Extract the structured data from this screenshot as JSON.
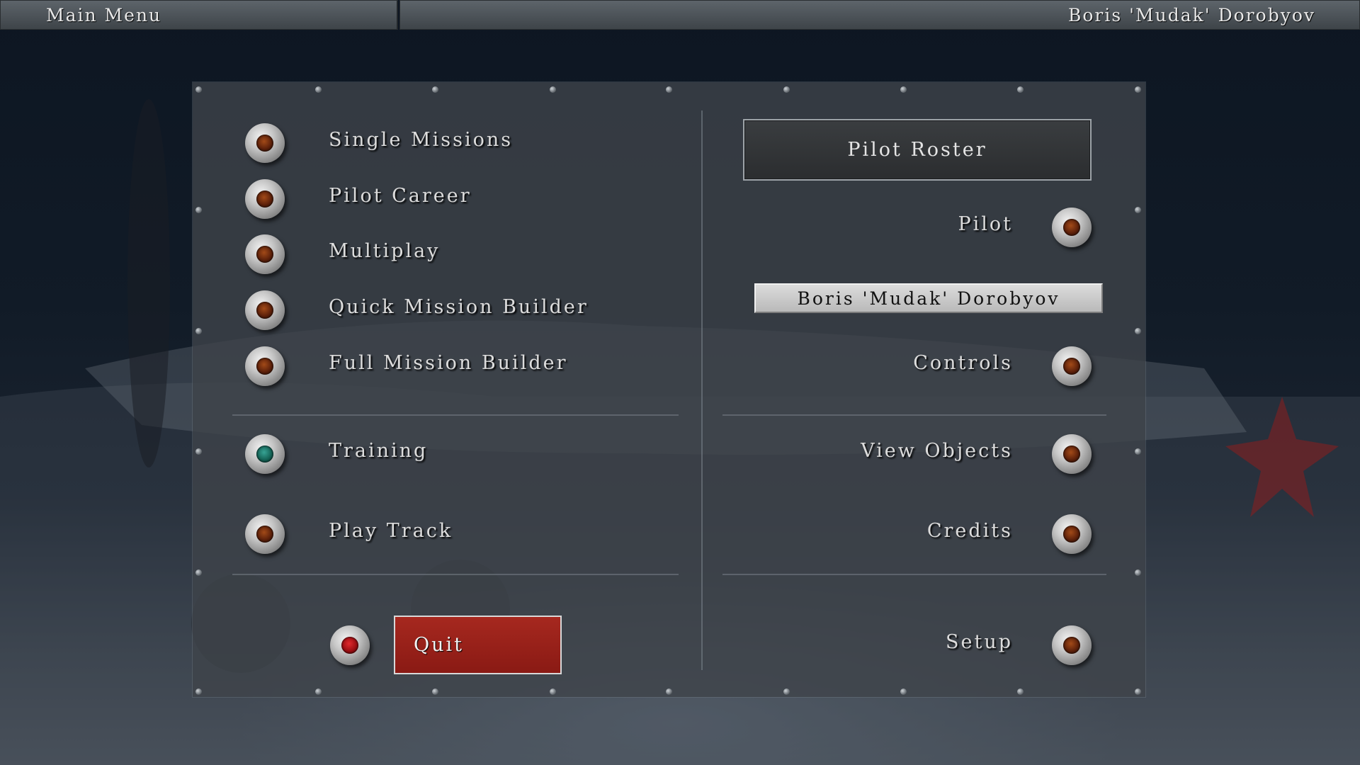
{
  "header": {
    "title": "Main Menu",
    "user": "Boris 'Mudak' Dorobyov"
  },
  "left_menu": {
    "items": [
      {
        "label": "Single Missions",
        "indicator": "amber"
      },
      {
        "label": "Pilot Career",
        "indicator": "amber"
      },
      {
        "label": "Multiplay",
        "indicator": "amber"
      },
      {
        "label": "Quick Mission Builder",
        "indicator": "amber"
      },
      {
        "label": "Full Mission Builder",
        "indicator": "amber"
      },
      {
        "label": "Training",
        "indicator": "green"
      },
      {
        "label": "Play Track",
        "indicator": "amber"
      }
    ],
    "quit_label": "Quit"
  },
  "right_menu": {
    "roster_label": "Pilot Roster",
    "pilot_label": "Pilot",
    "pilot_name": "Boris 'Mudak' Dorobyov",
    "controls_label": "Controls",
    "view_objects_label": "View Objects",
    "credits_label": "Credits",
    "setup_label": "Setup"
  },
  "colors": {
    "panel": "#3e444a",
    "quit_button": "#a6281f",
    "amber_indicator": "#a24a18",
    "green_indicator": "#37a394",
    "red_indicator": "#e02a2e"
  }
}
